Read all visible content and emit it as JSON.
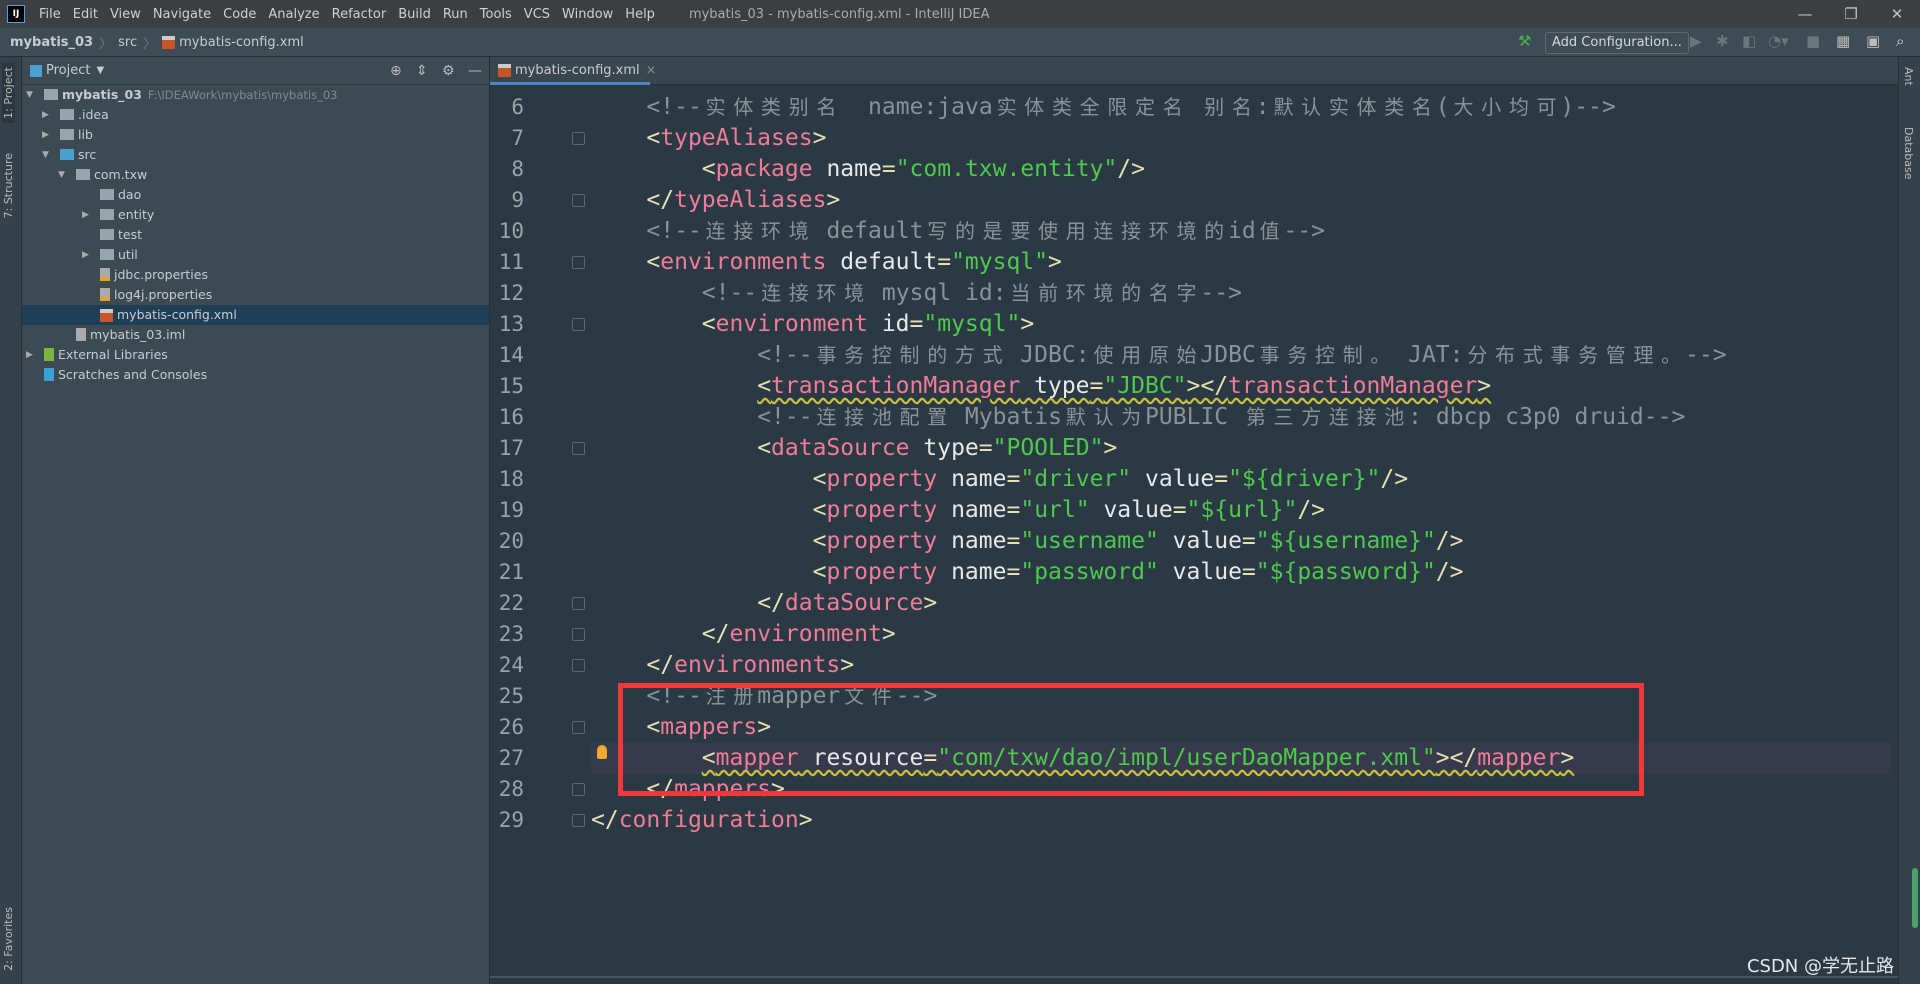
{
  "titlebar": {
    "menus": [
      "File",
      "Edit",
      "View",
      "Navigate",
      "Code",
      "Analyze",
      "Refactor",
      "Build",
      "Run",
      "Tools",
      "VCS",
      "Window",
      "Help"
    ],
    "title": "mybatis_03 - mybatis-config.xml - IntelliJ IDEA",
    "logo": "IJ"
  },
  "navbar": {
    "crumbs": [
      "mybatis_03",
      "src",
      "mybatis-config.xml"
    ],
    "add_config": "Add Configuration..."
  },
  "left_tabs": [
    "1: Project",
    "7: Structure",
    "2: Favorites"
  ],
  "right_tabs": [
    "Ant",
    "Database"
  ],
  "project": {
    "title": "Project",
    "root_path": "F:\\IDEAWork\\mybatis\\mybatis_03",
    "tree": [
      {
        "label": "mybatis_03",
        "depth": 0,
        "arrow": "open",
        "kind": "module",
        "bold": true
      },
      {
        "label": ".idea",
        "depth": 1,
        "arrow": "closed",
        "kind": "folder"
      },
      {
        "label": "lib",
        "depth": 1,
        "arrow": "closed",
        "kind": "folder"
      },
      {
        "label": "src",
        "depth": 1,
        "arrow": "open",
        "kind": "src"
      },
      {
        "label": "com.txw",
        "depth": 2,
        "arrow": "open",
        "kind": "package"
      },
      {
        "label": "dao",
        "depth": 3,
        "arrow": "",
        "kind": "package"
      },
      {
        "label": "entity",
        "depth": 3,
        "arrow": "closed",
        "kind": "package"
      },
      {
        "label": "test",
        "depth": 3,
        "arrow": "",
        "kind": "package"
      },
      {
        "label": "util",
        "depth": 3,
        "arrow": "closed",
        "kind": "package"
      },
      {
        "label": "jdbc.properties",
        "depth": 3,
        "arrow": "",
        "kind": "properties"
      },
      {
        "label": "log4j.properties",
        "depth": 3,
        "arrow": "",
        "kind": "properties"
      },
      {
        "label": "mybatis-config.xml",
        "depth": 3,
        "arrow": "",
        "kind": "xml",
        "selected": true
      },
      {
        "label": "mybatis_03.iml",
        "depth": 2,
        "arrow": "",
        "kind": "iml"
      },
      {
        "label": "External Libraries",
        "depth": 0,
        "arrow": "closed",
        "kind": "libs"
      },
      {
        "label": "Scratches and Consoles",
        "depth": 0,
        "arrow": "",
        "kind": "scratch"
      }
    ]
  },
  "editor": {
    "tab": "mybatis-config.xml",
    "current_line": 27,
    "lines": [
      {
        "n": 6,
        "i": 1,
        "t": [
          [
            "cm",
            "<!--实体类别名  name:java实体类全限定名 别名:默认实体类名(大小均可)-->"
          ]
        ]
      },
      {
        "n": 7,
        "i": 1,
        "f": 1,
        "t": [
          [
            "br",
            "<"
          ],
          [
            "tg",
            "typeAliases"
          ],
          [
            "br",
            ">"
          ]
        ]
      },
      {
        "n": 8,
        "i": 2,
        "t": [
          [
            "br",
            "<"
          ],
          [
            "tg",
            "package"
          ],
          [
            "at",
            " name"
          ],
          [
            "eq",
            "="
          ],
          [
            "vl",
            "\"com.txw.entity\""
          ],
          [
            "br",
            "/>"
          ]
        ]
      },
      {
        "n": 9,
        "i": 1,
        "f": 1,
        "t": [
          [
            "br",
            "</"
          ],
          [
            "tg",
            "typeAliases"
          ],
          [
            "br",
            ">"
          ]
        ]
      },
      {
        "n": 10,
        "i": 1,
        "t": [
          [
            "cm",
            "<!--连接环境 default写的是要使用连接环境的id值-->"
          ]
        ]
      },
      {
        "n": 11,
        "i": 1,
        "f": 1,
        "t": [
          [
            "br",
            "<"
          ],
          [
            "tg",
            "environments"
          ],
          [
            "at",
            " default"
          ],
          [
            "eq",
            "="
          ],
          [
            "vl",
            "\"mysql\""
          ],
          [
            "br",
            ">"
          ]
        ]
      },
      {
        "n": 12,
        "i": 2,
        "t": [
          [
            "cm",
            "<!--连接环境 mysql id:当前环境的名字-->"
          ]
        ]
      },
      {
        "n": 13,
        "i": 2,
        "f": 1,
        "t": [
          [
            "br",
            "<"
          ],
          [
            "tg",
            "environment"
          ],
          [
            "at",
            " id"
          ],
          [
            "eq",
            "="
          ],
          [
            "vl",
            "\"mysql\""
          ],
          [
            "br",
            ">"
          ]
        ]
      },
      {
        "n": 14,
        "i": 3,
        "t": [
          [
            "cm",
            "<!--事务控制的方式 JDBC:使用原始JDBC事务控制。 JAT:分布式事务管理。-->"
          ]
        ]
      },
      {
        "n": 15,
        "i": 3,
        "s": 1,
        "t": [
          [
            "br",
            "<"
          ],
          [
            "tg",
            "transactionManager"
          ],
          [
            "at",
            " type"
          ],
          [
            "eq",
            "="
          ],
          [
            "vl",
            "\"JDBC\""
          ],
          [
            "br",
            "></"
          ],
          [
            "tg",
            "transactionManager"
          ],
          [
            "br",
            ">"
          ]
        ]
      },
      {
        "n": 16,
        "i": 3,
        "t": [
          [
            "cm",
            "<!--连接池配置 Mybatis默认为PUBLIC 第三方连接池: dbcp c3p0 druid-->"
          ]
        ]
      },
      {
        "n": 17,
        "i": 3,
        "f": 1,
        "t": [
          [
            "br",
            "<"
          ],
          [
            "tg",
            "dataSource"
          ],
          [
            "at",
            " type"
          ],
          [
            "eq",
            "="
          ],
          [
            "vl",
            "\"POOLED\""
          ],
          [
            "br",
            ">"
          ]
        ]
      },
      {
        "n": 18,
        "i": 4,
        "t": [
          [
            "br",
            "<"
          ],
          [
            "tg",
            "property"
          ],
          [
            "at",
            " name"
          ],
          [
            "eq",
            "="
          ],
          [
            "vl",
            "\"driver\""
          ],
          [
            "at",
            " value"
          ],
          [
            "eq",
            "="
          ],
          [
            "vl",
            "\"${driver}\""
          ],
          [
            "br",
            "/>"
          ]
        ]
      },
      {
        "n": 19,
        "i": 4,
        "t": [
          [
            "br",
            "<"
          ],
          [
            "tg",
            "property"
          ],
          [
            "at",
            " name"
          ],
          [
            "eq",
            "="
          ],
          [
            "vl",
            "\"url\""
          ],
          [
            "at",
            " value"
          ],
          [
            "eq",
            "="
          ],
          [
            "vl",
            "\"${url}\""
          ],
          [
            "br",
            "/>"
          ]
        ]
      },
      {
        "n": 20,
        "i": 4,
        "t": [
          [
            "br",
            "<"
          ],
          [
            "tg",
            "property"
          ],
          [
            "at",
            " name"
          ],
          [
            "eq",
            "="
          ],
          [
            "vl",
            "\"username\""
          ],
          [
            "at",
            " value"
          ],
          [
            "eq",
            "="
          ],
          [
            "vl",
            "\"${username}\""
          ],
          [
            "br",
            "/>"
          ]
        ]
      },
      {
        "n": 21,
        "i": 4,
        "t": [
          [
            "br",
            "<"
          ],
          [
            "tg",
            "property"
          ],
          [
            "at",
            " name"
          ],
          [
            "eq",
            "="
          ],
          [
            "vl",
            "\"password\""
          ],
          [
            "at",
            " value"
          ],
          [
            "eq",
            "="
          ],
          [
            "vl",
            "\"${password}\""
          ],
          [
            "br",
            "/>"
          ]
        ]
      },
      {
        "n": 22,
        "i": 3,
        "f": 1,
        "t": [
          [
            "br",
            "</"
          ],
          [
            "tg",
            "dataSource"
          ],
          [
            "br",
            ">"
          ]
        ]
      },
      {
        "n": 23,
        "i": 2,
        "f": 1,
        "t": [
          [
            "br",
            "</"
          ],
          [
            "tg",
            "environment"
          ],
          [
            "br",
            ">"
          ]
        ]
      },
      {
        "n": 24,
        "i": 1,
        "f": 1,
        "t": [
          [
            "br",
            "</"
          ],
          [
            "tg",
            "environments"
          ],
          [
            "br",
            ">"
          ]
        ]
      },
      {
        "n": 25,
        "i": 1,
        "t": [
          [
            "cm",
            "<!--注册mapper文件-->"
          ]
        ]
      },
      {
        "n": 26,
        "i": 1,
        "f": 1,
        "t": [
          [
            "br",
            "<"
          ],
          [
            "tg",
            "mappers"
          ],
          [
            "br",
            ">"
          ]
        ]
      },
      {
        "n": 27,
        "i": 2,
        "s": 1,
        "t": [
          [
            "br",
            "<"
          ],
          [
            "tg",
            "mapper"
          ],
          [
            "at",
            " resource"
          ],
          [
            "eq",
            "="
          ],
          [
            "vl",
            "\"com/txw/dao/impl/userDaoMapper.xml\""
          ],
          [
            "br",
            "></"
          ],
          [
            "tg",
            "mapper"
          ],
          [
            "br",
            ">"
          ]
        ]
      },
      {
        "n": 28,
        "i": 1,
        "f": 1,
        "t": [
          [
            "br",
            "</"
          ],
          [
            "tg",
            "mappers"
          ],
          [
            "br",
            ">"
          ]
        ]
      },
      {
        "n": 29,
        "i": 0,
        "f": 1,
        "t": [
          [
            "br",
            "</"
          ],
          [
            "tg",
            "configuration"
          ],
          [
            "br",
            ">"
          ]
        ]
      }
    ]
  },
  "highlight_color": "#f0383a",
  "watermark": "CSDN @学无止路"
}
